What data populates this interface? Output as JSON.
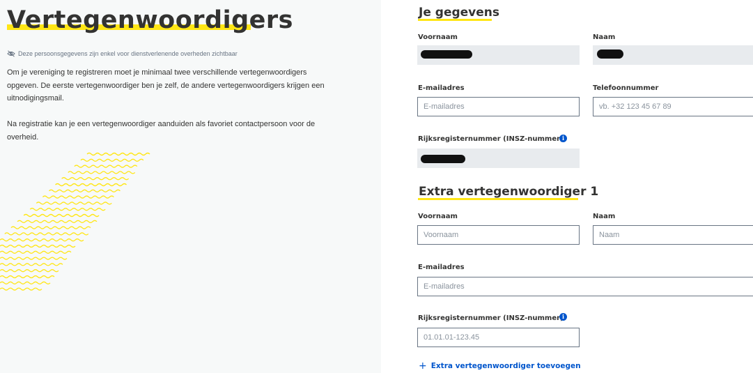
{
  "page": {
    "title": "Vertegenwoordigers",
    "privacy_note": "Deze persoonsgegevens zijn enkel voor dienstverlenende overheden zichtbaar",
    "intro_1": "Om je vereniging te registreren moet je minimaal twee verschillende vertegenwoordigers opgeven. De eerste vertegenwoordiger ben je zelf, de andere vertegenwoordigers krijgen een uitnodigingsmail.",
    "intro_2": "Na registratie kan je een vertegenwoordiger aanduiden als favoriet contactpersoon voor de overheid."
  },
  "own_data": {
    "heading": "Je gegevens",
    "firstname_label": "Voornaam",
    "lastname_label": "Naam",
    "email_label": "E-mailadres",
    "email_placeholder": "E-mailadres",
    "phone_label": "Telefoonnummer",
    "phone_placeholder": "vb. +32 123 45 67 89",
    "rrn_label": "Rijksregisternummer (INSZ-nummer)"
  },
  "extra_rep": {
    "heading": "Extra vertegenwoordiger 1",
    "firstname_label": "Voornaam",
    "firstname_placeholder": "Voornaam",
    "lastname_label": "Naam",
    "lastname_placeholder": "Naam",
    "email_label": "E-mailadres",
    "email_placeholder": "E-mailadres",
    "rrn_label": "Rijksregisternummer (INSZ-nummer)",
    "rrn_placeholder": "01.01.01-123.45"
  },
  "actions": {
    "add_rep_label": "Extra vertegenwoordiger toevoegen"
  },
  "icons": {
    "privacy": "eye-slash-icon",
    "info": "info-icon",
    "add": "plus-icon"
  },
  "colors": {
    "accent_yellow": "#ffe615",
    "link_blue": "#0055cc",
    "text": "#333332",
    "muted": "#687483",
    "readonly_bg": "#e8ebee"
  }
}
